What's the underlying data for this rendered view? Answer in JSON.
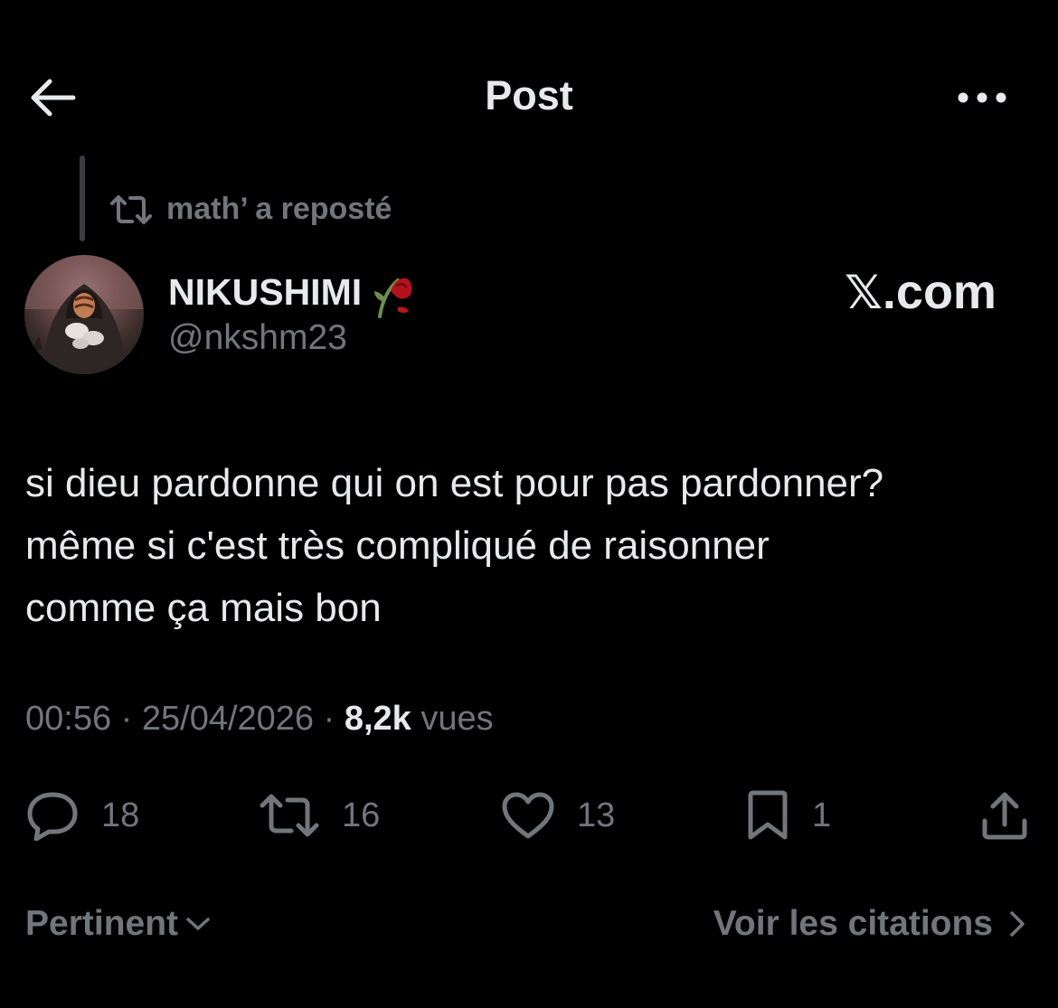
{
  "header": {
    "title": "Post",
    "back_icon": "back-arrow-icon",
    "more_icon": "more-dots-icon"
  },
  "repost": {
    "text": "math’ a reposté",
    "icon": "repost-icon"
  },
  "author": {
    "display_name": "NIKUSHIMI",
    "emoji": "🥀",
    "handle": "@nkshm23",
    "avatar_icon": "avatar"
  },
  "watermark": {
    "logo_letter": "𝕏",
    "text": ".com"
  },
  "post": {
    "lines": [
      "si dieu pardonne qui on est pour pas pardonner?",
      "même si c'est très compliqué de raisonner",
      "comme ça mais bon"
    ]
  },
  "meta": {
    "time": "00:56",
    "sep1": " · ",
    "date": "25/04/2026",
    "sep2": " · ",
    "views_count": "8,2k",
    "views_label": " vues"
  },
  "actions": {
    "replies": "18",
    "reposts": "16",
    "likes": "13",
    "bookmarks": "1"
  },
  "footer": {
    "sort_label": "Pertinent",
    "quotes_label": "Voir les citations"
  },
  "colors": {
    "background": "#000000",
    "text": "#e7e9ea",
    "muted": "#71767b"
  }
}
